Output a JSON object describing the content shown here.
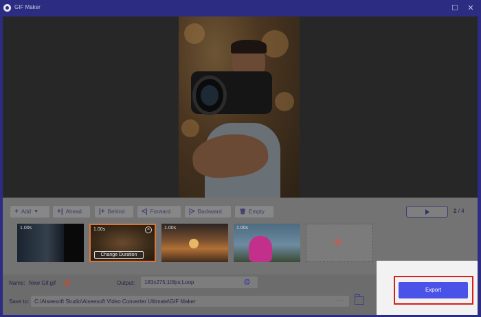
{
  "window": {
    "title": "GIF Maker",
    "maximize_glyph": "☐",
    "close_glyph": "✕"
  },
  "toolbar": {
    "add": {
      "label": "Add",
      "icon": "+",
      "dropdown": "▼"
    },
    "ahead": {
      "label": "Ahead",
      "icon": "+|"
    },
    "behind": {
      "label": "Behind",
      "icon": "|+"
    },
    "forward": {
      "label": "Forward",
      "icon": "<|"
    },
    "backward": {
      "label": "Backward",
      "icon": "|>"
    },
    "empty": {
      "label": "Empty",
      "icon": "🗑"
    }
  },
  "player": {
    "current": "2",
    "total": "4",
    "separator": "/"
  },
  "clips": [
    {
      "duration": "1.00s"
    },
    {
      "duration": "1.00s",
      "close_glyph": "×",
      "change_duration": "Change Duration"
    },
    {
      "duration": "1.00s"
    },
    {
      "duration": "1.00s"
    }
  ],
  "add_slot": {
    "plus": "+"
  },
  "settings": {
    "name_label": "Name:",
    "name_value": "New Gif.gif",
    "output_label": "Output:",
    "output_value": "183x275;10fps;Loop",
    "save_label": "Save to:",
    "save_value": "C:\\Aiseesoft Studio\\Aiseesoft Video Converter Ultimate\\GIF Maker",
    "browse_glyph": "···"
  },
  "export": {
    "label": "Export"
  },
  "colors": {
    "accent": "#4a52e8",
    "highlight": "#d91c1c",
    "titlebar": "#2d2c83",
    "selected_clip": "#d9773a"
  }
}
